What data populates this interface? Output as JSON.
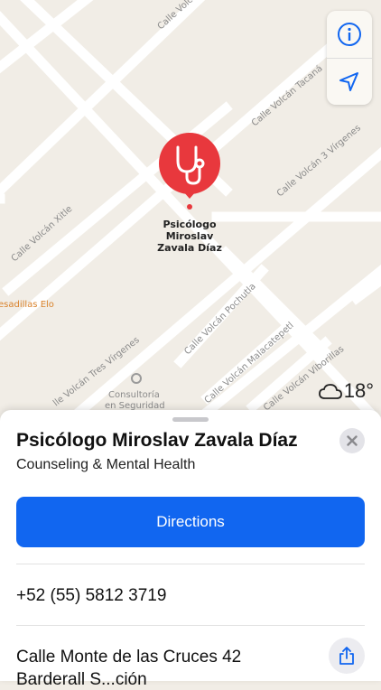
{
  "map": {
    "pin_label": [
      "Psicólogo",
      "Miroslav",
      "Zavala Díaz"
    ],
    "streets": {
      "volcan_top": "Calle Volcá",
      "tacana": "Calle Volcán Tacaná",
      "tres_virgenes_top": "Calle Volcán 3 Vírgenes",
      "xitle": "Calle Volcán Xitle",
      "pochutla": "Calle Volcán Pochutla",
      "tres_virgenes_bottom": "lle Volcán Tres Vírgenes",
      "malacatepetl": "Calle Volcán Malacatepetl",
      "viborillas": "Calle Volcán Viborillas"
    },
    "poi_quesadillas": "esadillas Elo",
    "poi_consultoria": [
      "Consultoría",
      "en Seguridad"
    ]
  },
  "controls": {
    "info_icon": "info-icon",
    "location_icon": "location-arrow-icon"
  },
  "weather": {
    "icon": "cloud-icon",
    "temperature": "18°"
  },
  "place": {
    "title": "Psicólogo Miroslav Zavala Díaz",
    "category": "Counseling & Mental Health",
    "directions_label": "Directions",
    "phone": "+52 (55) 5812 3719",
    "address_line1": "Calle Monte de las Cruces 42",
    "address_line2": "Barderall S...ción"
  },
  "colors": {
    "pin": "#e8383d",
    "accent": "#1166f0",
    "map_bg": "#f1ede6"
  }
}
